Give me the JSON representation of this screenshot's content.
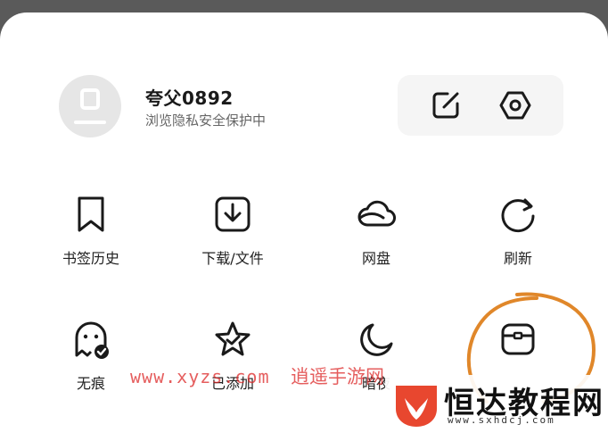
{
  "profile": {
    "username": "夸父0892",
    "subtitle": "浏览隐私安全保护中",
    "avatar_icon": "user-placeholder-icon"
  },
  "actions": [
    {
      "icon": "edit-icon"
    },
    {
      "icon": "settings-hex-icon"
    }
  ],
  "grid": [
    {
      "label": "书签历史",
      "icon": "bookmark-icon"
    },
    {
      "label": "下载/文件",
      "icon": "download-icon"
    },
    {
      "label": "网盘",
      "icon": "cloud-icon"
    },
    {
      "label": "刷新",
      "icon": "refresh-icon"
    },
    {
      "label": "无痕",
      "icon": "ghost-icon"
    },
    {
      "label": "已添加",
      "icon": "star-icon"
    },
    {
      "label": "暗夜",
      "icon": "moon-icon"
    },
    {
      "label": "",
      "icon": "toolbox-icon"
    }
  ],
  "watermark": {
    "url": "www.xyzs.com",
    "text": "逍遥手游网"
  },
  "site_logo": {
    "name": "恒达教程网",
    "url": "www.sxhdcj.com",
    "accent": "#e8472f"
  },
  "colors": {
    "scrim": "#5a5a5a",
    "sheet": "#ffffff",
    "scribble": "#e0872a"
  }
}
